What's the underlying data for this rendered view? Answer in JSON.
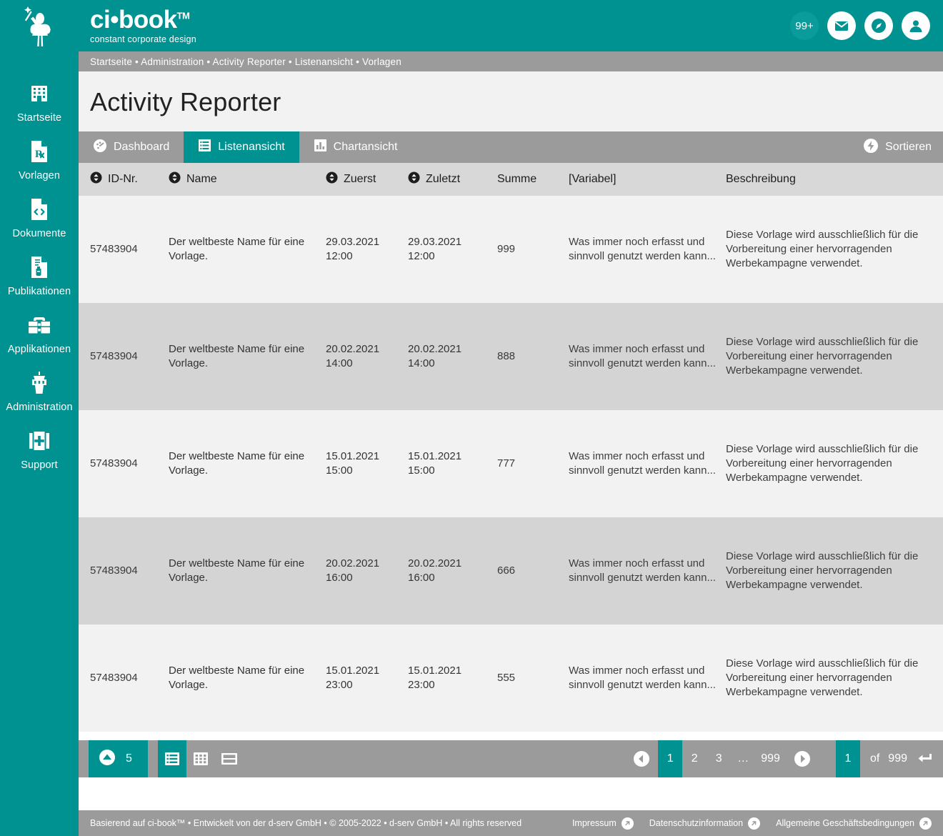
{
  "brand": {
    "name": "ci•book",
    "tm": "TM",
    "tagline": "constant corporate design",
    "logo_icon": "fairy-logo-icon"
  },
  "header": {
    "notification_badge": "99+",
    "mail_icon": "mail-icon",
    "compass_icon": "compass-icon",
    "account_icon": "account-icon"
  },
  "breadcrumb": "Startseite • Administration • Activity Reporter • Listenansicht • Vorlagen",
  "page_title": "Activity Reporter",
  "sidebar": {
    "items": [
      {
        "label": "Startseite",
        "icon": "building-icon"
      },
      {
        "label": "Vorlagen",
        "icon": "prescription-document-icon"
      },
      {
        "label": "Dokumente",
        "icon": "code-document-icon"
      },
      {
        "label": "Publikationen",
        "icon": "bottle-document-icon"
      },
      {
        "label": "Applikationen",
        "icon": "toolbox-icon"
      },
      {
        "label": "Administration",
        "icon": "control-tower-icon"
      },
      {
        "label": "Support",
        "icon": "first-aid-icon"
      }
    ]
  },
  "tabs": [
    {
      "label": "Dashboard",
      "icon": "gauge-icon",
      "active": false
    },
    {
      "label": "Listenansicht",
      "icon": "list-icon",
      "active": true
    },
    {
      "label": "Chartansicht",
      "icon": "bar-chart-icon",
      "active": false
    }
  ],
  "sort_button": {
    "label": "Sortieren",
    "icon": "lightning-icon"
  },
  "table": {
    "columns": [
      {
        "label": "ID-Nr.",
        "sortable": true
      },
      {
        "label": "Name",
        "sortable": true
      },
      {
        "label": "Zuerst",
        "sortable": true
      },
      {
        "label": "Zuletzt",
        "sortable": true
      },
      {
        "label": "Summe",
        "sortable": false
      },
      {
        "label": "[Variabel]",
        "sortable": false
      },
      {
        "label": "Beschreibung",
        "sortable": false
      }
    ],
    "rows": [
      {
        "id": "57483904",
        "name": "Der weltbeste Name für eine Vorlage.",
        "first": "29.03.2021 12:00",
        "last": "29.03.2021 12:00",
        "sum": "999",
        "variable": "Was immer noch erfasst und sinnvoll genutzt werden kann...",
        "description": "Diese Vorlage wird ausschließlich für die Vorbereitung einer hervorragenden Werbekampagne verwendet."
      },
      {
        "id": "57483904",
        "name": "Der weltbeste Name für eine Vorlage.",
        "first": "20.02.2021 14:00",
        "last": "20.02.2021 14:00",
        "sum": "888",
        "variable": "Was immer noch erfasst und sinnvoll genutzt werden kann...",
        "description": "Diese Vorlage wird ausschließlich für die Vorbereitung einer hervorragenden Werbekampagne verwendet."
      },
      {
        "id": "57483904",
        "name": "Der weltbeste Name für eine Vorlage.",
        "first": "15.01.2021 15:00",
        "last": "15.01.2021 15:00",
        "sum": "777",
        "variable": "Was immer noch erfasst und sinnvoll genutzt werden kann...",
        "description": "Diese Vorlage wird ausschließlich für die Vorbereitung einer hervorragenden Werbekampagne verwendet."
      },
      {
        "id": "57483904",
        "name": "Der weltbeste Name für eine Vorlage.",
        "first": "20.02.2021 16:00",
        "last": "20.02.2021 16:00",
        "sum": "666",
        "variable": "Was immer noch erfasst und sinnvoll genutzt werden kann...",
        "description": "Diese Vorlage wird ausschließlich für die Vorbereitung einer hervorragenden Werbekampagne verwendet."
      },
      {
        "id": "57483904",
        "name": "Der weltbeste Name für eine Vorlage.",
        "first": "15.01.2021 23:00",
        "last": "15.01.2021 23:00",
        "sum": "555",
        "variable": "Was immer noch erfasst und sinnvoll genutzt werden kann...",
        "description": "Diese Vorlage wird ausschließlich für die Vorbereitung einer hervorragenden Werbekampagne verwendet."
      }
    ]
  },
  "pagination": {
    "rows_per_page": "5",
    "rows_caret_icon": "caret-up-icon",
    "view_modes": [
      {
        "icon": "list-view-icon",
        "active": true
      },
      {
        "icon": "grid-view-icon",
        "active": false
      },
      {
        "icon": "split-view-icon",
        "active": false
      }
    ],
    "prev_icon": "arrow-left-icon",
    "next_icon": "arrow-right-icon",
    "pages": [
      "1",
      "2",
      "3",
      "…",
      "999"
    ],
    "current_page": "1",
    "jump_value": "1",
    "of_label": "of",
    "total_pages": "999",
    "enter_icon": "enter-key-icon"
  },
  "footer": {
    "copyright": "Basierend auf ci-book™ • Entwickelt von der d-serv GmbH • © 2005-2022 • d-serv GmbH • All rights reserved",
    "links": [
      {
        "label": "Impressum",
        "icon": "external-link-icon"
      },
      {
        "label": "Datenschutzinformation",
        "icon": "external-link-icon"
      },
      {
        "label": "Allgemeine Geschäftsbedingungen",
        "icon": "external-link-icon"
      }
    ]
  },
  "colors": {
    "teal": "#009191",
    "gray_bar": "#9b9b9b",
    "row_light": "#f2f2f2",
    "row_dark": "#d4d4d4",
    "header_row": "#d8d8d8"
  }
}
